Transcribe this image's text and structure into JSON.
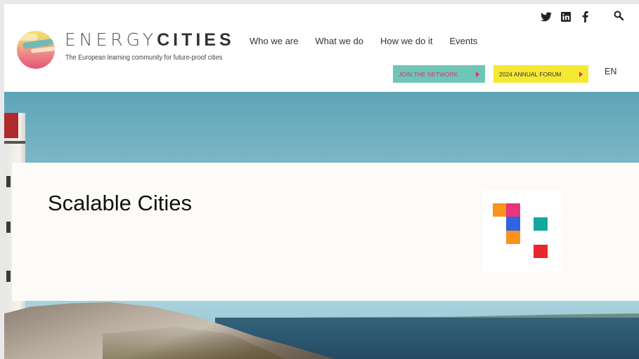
{
  "brand": {
    "name_light": "ENERGY",
    "name_bold": "CITIES",
    "tagline": "The European learning community for future-proof cities"
  },
  "nav": {
    "items": [
      {
        "label": "Who we are"
      },
      {
        "label": "What we do"
      },
      {
        "label": "How we do it"
      },
      {
        "label": "Events"
      }
    ]
  },
  "social": {
    "icons": [
      "twitter-icon",
      "linkedin-icon",
      "facebook-icon"
    ],
    "search_icon": "search-icon"
  },
  "cta": {
    "join_label": "JOIN THE NETWORK",
    "forum_label": "2024 ANNUAL FORUM"
  },
  "language": "EN",
  "page": {
    "title": "Scalable Cities"
  },
  "colors": {
    "join_bg": "#6ec6b7",
    "join_text": "#d8347a",
    "forum_bg": "#f5e832",
    "logo_orange": "#f7941d",
    "logo_pink": "#e8357e",
    "logo_blue": "#2f63e0",
    "logo_teal": "#12a89b",
    "logo_red": "#e8262e"
  }
}
